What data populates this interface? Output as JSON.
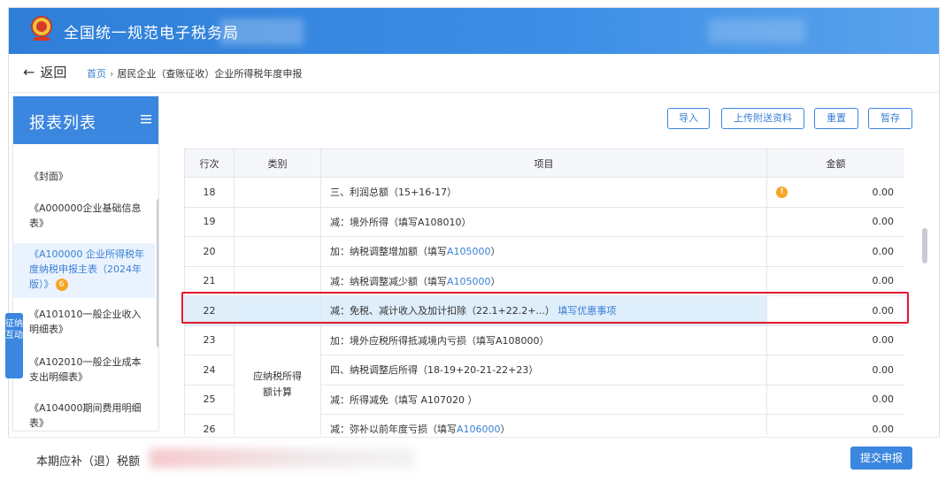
{
  "app": {
    "title": "全国统一规范电子税务局"
  },
  "nav": {
    "back_label": "返回",
    "breadcrumb_home": "首页",
    "breadcrumb_sep": "›",
    "breadcrumb_current": "居民企业（查账征收）企业所得税年度申报"
  },
  "sidebar": {
    "title": "报表列表",
    "items": [
      {
        "label": "《封面》"
      },
      {
        "label": "《A000000企业基础信息表》"
      },
      {
        "label": "《A100000 企业所得税年度纳税申报主表（2024年版）》",
        "badge": "6",
        "active": true
      },
      {
        "label": "《A101010一般企业收入明细表》"
      },
      {
        "label": "《A102010一般企业成本支出明细表》"
      },
      {
        "label": "《A104000期间费用明细表》"
      }
    ]
  },
  "side_tab": {
    "label": "征纳互动"
  },
  "toolbar": {
    "import_label": "导入",
    "upload_label": "上传附送资料",
    "reset_label": "重置",
    "save_label": "暂存"
  },
  "table": {
    "headers": [
      "行次",
      "类别",
      "项目",
      "金额"
    ],
    "category_label": "应纳税所得额计算",
    "rows": [
      {
        "no": "18",
        "item": "三、利润总额（15+16-17）",
        "link": "",
        "suffix": "",
        "amount": "0.00",
        "warning": true
      },
      {
        "no": "19",
        "item": "减：境外所得（填写A108010）",
        "link": "",
        "suffix": "",
        "amount": "0.00"
      },
      {
        "no": "20",
        "item": "加：纳税调整增加额（填写",
        "link": "A105000",
        "suffix": "）",
        "amount": "0.00"
      },
      {
        "no": "21",
        "item": "减：纳税调整减少额（填写",
        "link": "A105000",
        "suffix": "）",
        "amount": "0.00"
      },
      {
        "no": "22",
        "item": "减：免税、减计收入及加计扣除（22.1+22.2+...）",
        "link": "填写优惠事项",
        "suffix": "",
        "amount": "0.00",
        "highlighted": true
      },
      {
        "no": "23",
        "item": "加：境外应税所得抵减境内亏损（填写A108000）",
        "link": "",
        "suffix": "",
        "amount": "0.00"
      },
      {
        "no": "24",
        "item": "四、纳税调整后所得（18-19+20-21-22+23）",
        "link": "",
        "suffix": "",
        "amount": "0.00"
      },
      {
        "no": "25",
        "item": "减：所得减免（填写 A107020 ）",
        "link": "",
        "suffix": "",
        "amount": "0.00"
      },
      {
        "no": "26",
        "item": "减：弥补以前年度亏损（填写",
        "link": "A106000",
        "suffix": "）",
        "amount": "0.00"
      }
    ]
  },
  "footer": {
    "tax_label": "本期应补（退）税额",
    "submit_label": "提交申报"
  },
  "colors": {
    "brand_blue": "#3b86df",
    "highlight_red": "#e0182d",
    "warning_orange": "#f5a623"
  },
  "icons": {
    "emblem": "tax-emblem-icon",
    "back": "arrow-left-icon",
    "menu": "list-menu-icon",
    "warning": "warning-icon"
  }
}
